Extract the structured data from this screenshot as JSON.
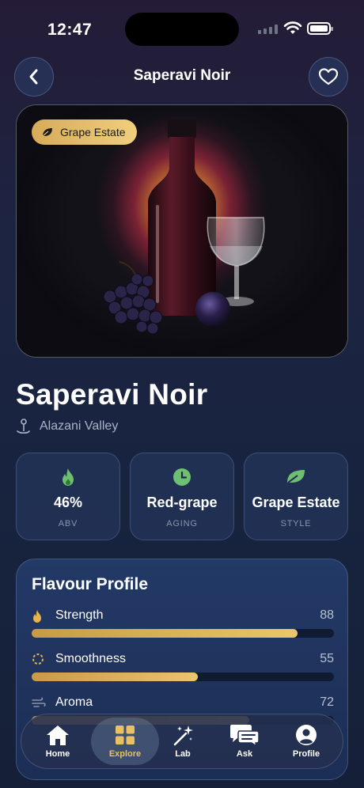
{
  "status_bar": {
    "time": "12:47"
  },
  "header": {
    "title": "Saperavi Noir",
    "back_icon": "chevron-left-icon",
    "favorite_icon": "heart-icon"
  },
  "hero": {
    "badge_label": "Grape Estate",
    "badge_icon": "leaf-icon",
    "image_description_icon": "wine-bottle-illustration"
  },
  "product": {
    "name": "Saperavi Noir",
    "location": "Alazani Valley",
    "location_icon": "location-pin-icon"
  },
  "stats": [
    {
      "icon": "flame-icon",
      "value": "46%",
      "label": "ABV"
    },
    {
      "icon": "clock-icon",
      "value": "Red-grape",
      "label": "AGING"
    },
    {
      "icon": "leaf-icon",
      "value": "Grape Estate",
      "label": "STYLE"
    }
  ],
  "flavour_profile": {
    "title": "Flavour Profile",
    "rows": [
      {
        "icon": "flame-icon",
        "label": "Strength",
        "value": "88",
        "percent": 88
      },
      {
        "icon": "circle-dashed-icon",
        "label": "Smoothness",
        "value": "55",
        "percent": 55
      },
      {
        "icon": "wind-icon",
        "label": "Aroma",
        "value": "72",
        "percent": 72
      }
    ]
  },
  "tabbar": {
    "items": [
      {
        "label": "Home",
        "icon": "home-icon"
      },
      {
        "label": "Explore",
        "icon": "grid-icon",
        "active": true
      },
      {
        "label": "Lab",
        "icon": "sparkles-icon"
      },
      {
        "label": "Ask",
        "icon": "chat-bubbles-icon"
      },
      {
        "label": "Profile",
        "icon": "user-icon"
      }
    ]
  },
  "colors": {
    "accent_gold": "#e8c065",
    "background": "#1d2442",
    "card": "#233966"
  }
}
